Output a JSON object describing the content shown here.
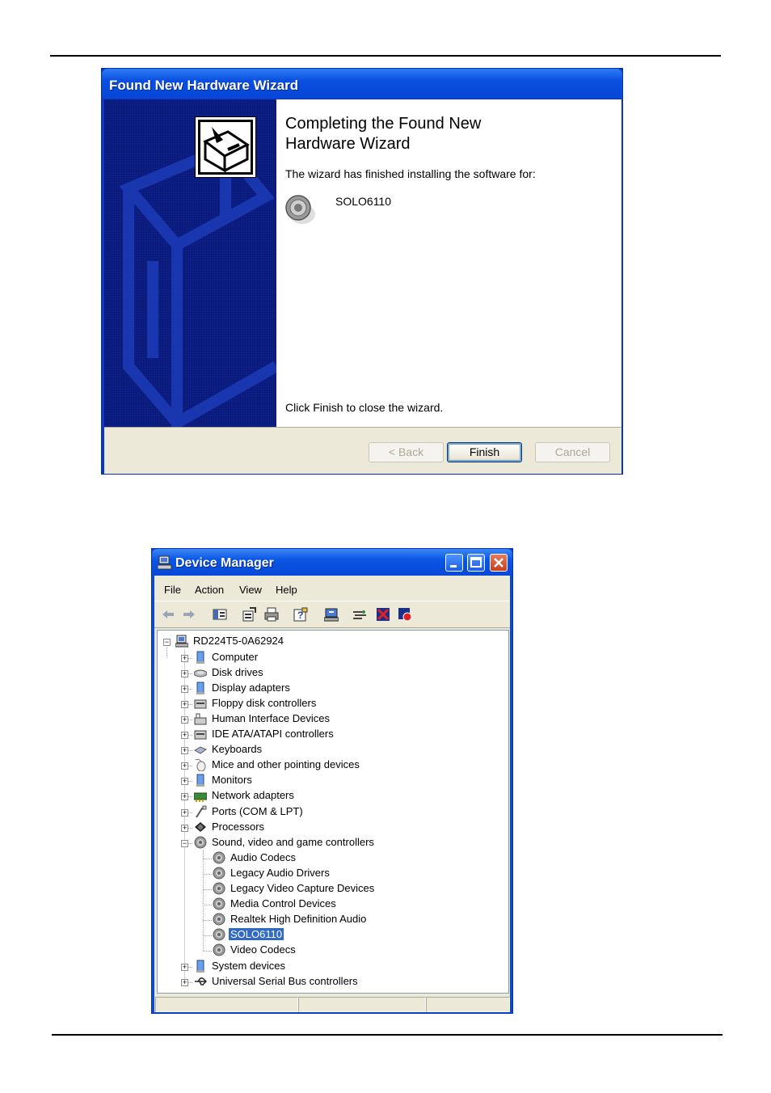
{
  "wizard": {
    "title": "Found New Hardware Wizard",
    "heading_line1": "Completing the Found New",
    "heading_line2": "Hardware Wizard",
    "finished_text": "The wizard has finished installing the software for:",
    "device_name": "SOLO6110",
    "close_text": "Click Finish to close the wizard.",
    "buttons": {
      "back": "< Back",
      "finish": "Finish",
      "cancel": "Cancel"
    }
  },
  "device_manager": {
    "title": "Device Manager",
    "menu": [
      "File",
      "Action",
      "View",
      "Help"
    ],
    "toolbar_icons": [
      "back-arrow-icon",
      "forward-arrow-icon",
      "show-hide-console-tree-icon",
      "properties-icon",
      "print-icon",
      "help-icon",
      "update-driver-icon",
      "scan-hardware-icon",
      "uninstall-icon",
      "disable-icon"
    ],
    "root": "RD224T5-0A62924",
    "categories": [
      {
        "label": "Computer",
        "icon": "computer-icon"
      },
      {
        "label": "Disk drives",
        "icon": "disk-drive-icon"
      },
      {
        "label": "Display adapters",
        "icon": "display-adapter-icon"
      },
      {
        "label": "Floppy disk controllers",
        "icon": "floppy-controller-icon"
      },
      {
        "label": "Human Interface Devices",
        "icon": "hid-icon"
      },
      {
        "label": "IDE ATA/ATAPI controllers",
        "icon": "ide-controller-icon"
      },
      {
        "label": "Keyboards",
        "icon": "keyboard-icon"
      },
      {
        "label": "Mice and other pointing devices",
        "icon": "mouse-icon"
      },
      {
        "label": "Monitors",
        "icon": "monitor-icon"
      },
      {
        "label": "Network adapters",
        "icon": "network-adapter-icon"
      },
      {
        "label": "Ports (COM & LPT)",
        "icon": "port-icon"
      },
      {
        "label": "Processors",
        "icon": "processor-icon"
      }
    ],
    "sound_category": "Sound, video and game controllers",
    "sound_children": [
      "Audio Codecs",
      "Legacy Audio Drivers",
      "Legacy Video Capture Devices",
      "Media Control Devices",
      "Realtek High Definition Audio",
      "SOLO6110",
      "Video Codecs"
    ],
    "selected_child": "SOLO6110",
    "after_categories": [
      {
        "label": "System devices",
        "icon": "system-devices-icon"
      },
      {
        "label": "Universal Serial Bus controllers",
        "icon": "usb-icon"
      }
    ]
  },
  "colors": {
    "xp_blue": "#0a4ad8",
    "selection": "#316ac5",
    "face": "#ece9d8"
  }
}
